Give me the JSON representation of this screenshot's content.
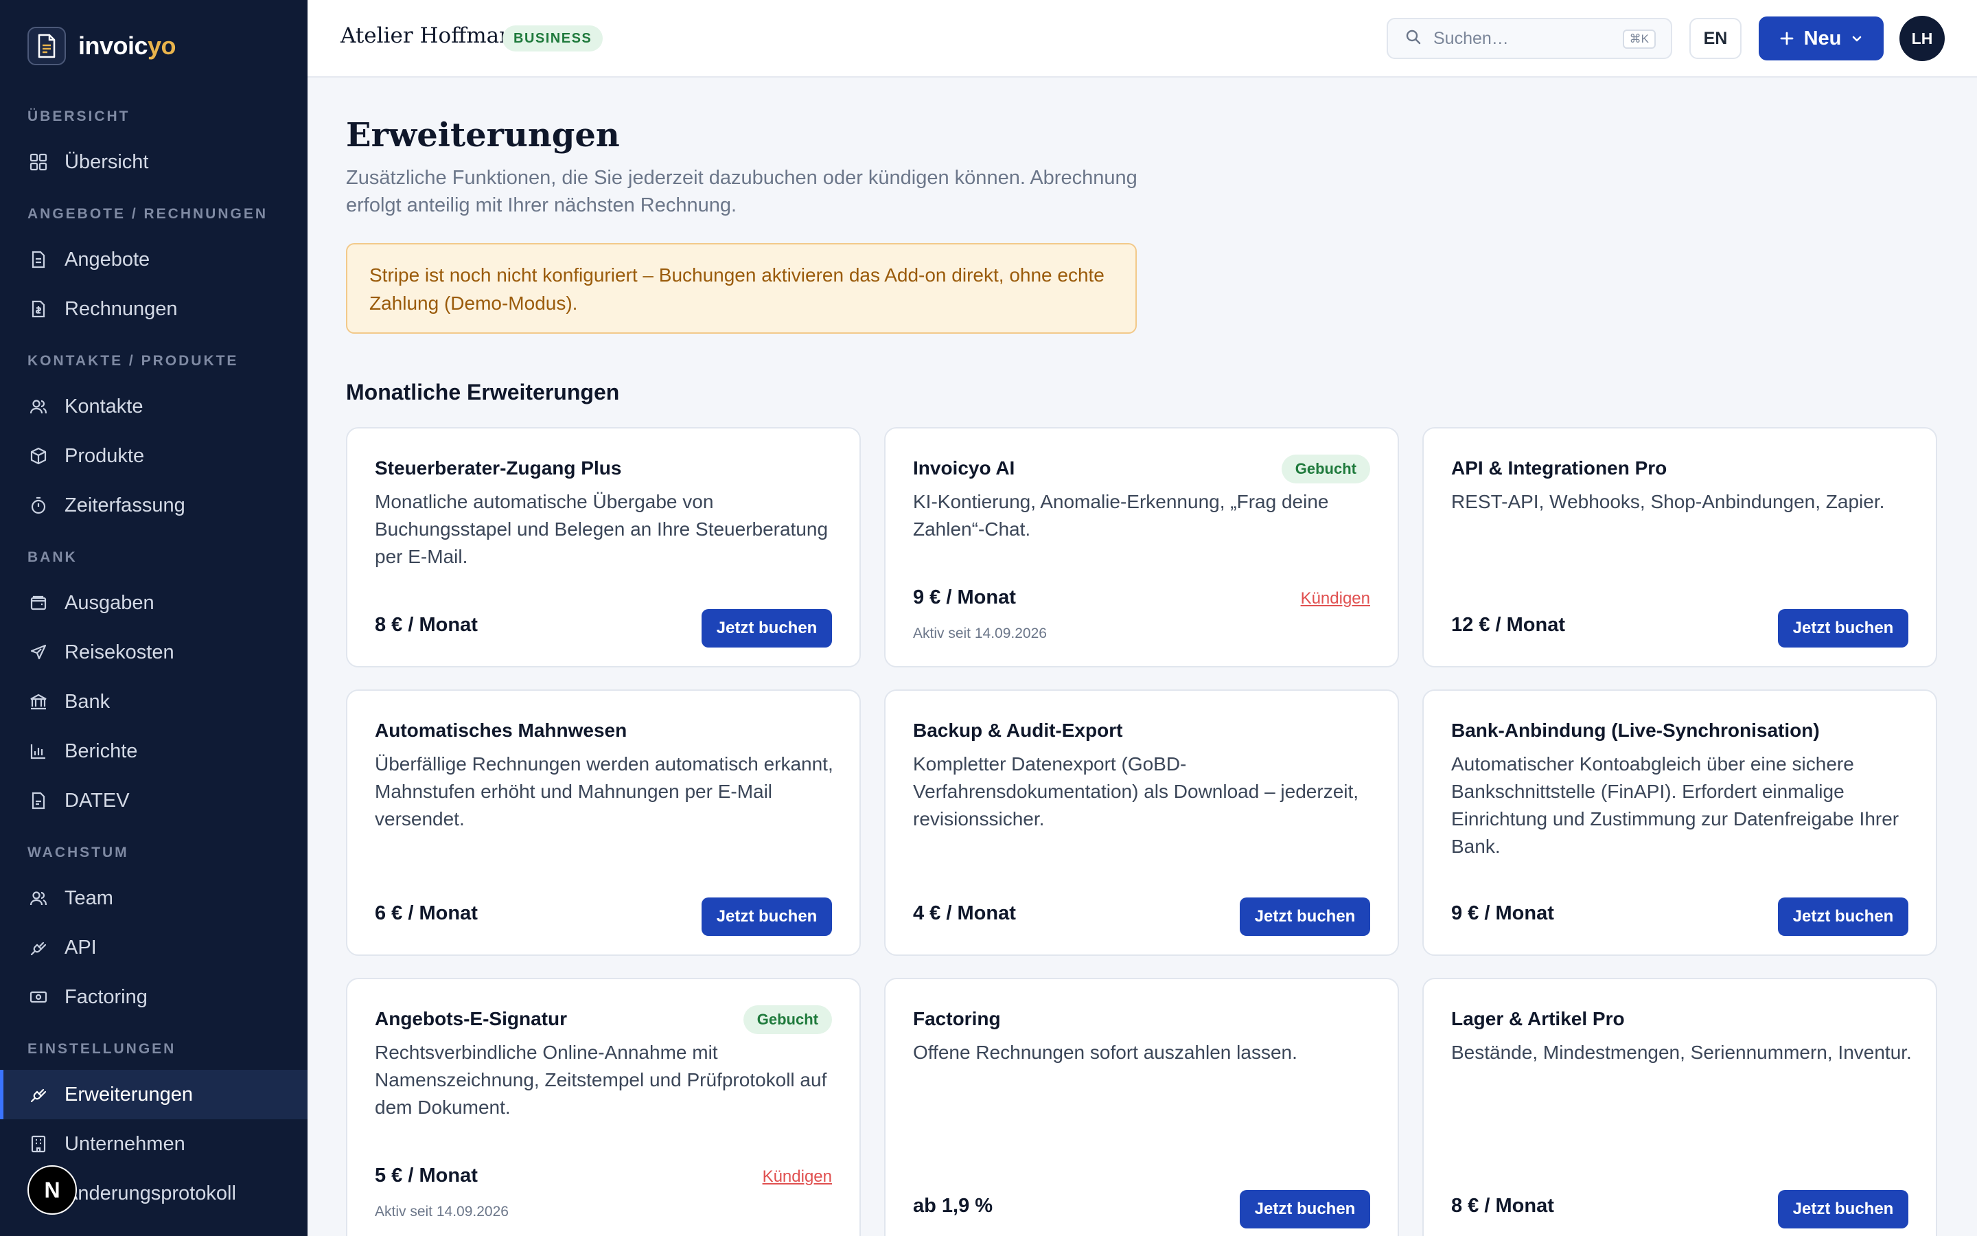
{
  "brand": {
    "name_main": "invoic",
    "name_accent": "yo"
  },
  "sidebar": {
    "sections": [
      {
        "title": "ÜBERSICHT",
        "items": [
          {
            "label": "Übersicht",
            "icon": "grid-icon"
          }
        ]
      },
      {
        "title": "ANGEBOTE / RECHNUNGEN",
        "items": [
          {
            "label": "Angebote",
            "icon": "document-icon"
          },
          {
            "label": "Rechnungen",
            "icon": "invoice-icon"
          }
        ]
      },
      {
        "title": "KONTAKTE / PRODUKTE",
        "items": [
          {
            "label": "Kontakte",
            "icon": "users-icon"
          },
          {
            "label": "Produkte",
            "icon": "box-icon"
          },
          {
            "label": "Zeiterfassung",
            "icon": "stopwatch-icon"
          }
        ]
      },
      {
        "title": "BANK",
        "items": [
          {
            "label": "Ausgaben",
            "icon": "wallet-icon"
          },
          {
            "label": "Reisekosten",
            "icon": "plane-icon"
          },
          {
            "label": "Bank",
            "icon": "bank-icon"
          },
          {
            "label": "Berichte",
            "icon": "bar-chart-icon"
          },
          {
            "label": "DATEV",
            "icon": "file-icon"
          }
        ]
      },
      {
        "title": "WACHSTUM",
        "items": [
          {
            "label": "Team",
            "icon": "users-icon"
          },
          {
            "label": "API",
            "icon": "plug-icon"
          },
          {
            "label": "Factoring",
            "icon": "cash-icon"
          }
        ]
      },
      {
        "title": "EINSTELLUNGEN",
        "items": [
          {
            "label": "Erweiterungen",
            "icon": "plug-icon",
            "active": true
          },
          {
            "label": "Unternehmen",
            "icon": "building-icon"
          },
          {
            "label": "Änderungsprotokoll",
            "icon": "history-icon"
          }
        ]
      }
    ],
    "dev_badge": "N"
  },
  "header": {
    "company": "Atelier Hoffmann",
    "plan": "BUSINESS",
    "search_placeholder": "Suchen…",
    "search_shortcut": "⌘K",
    "language": "EN",
    "new_label": "Neu",
    "avatar": "LH"
  },
  "page": {
    "title": "Erweiterungen",
    "subtitle": "Zusätzliche Funktionen, die Sie jederzeit dazubuchen oder kündigen können. Abrechnung erfolgt anteilig mit Ihrer nächsten Rechnung.",
    "alert": "Stripe ist noch nicht konfiguriert – Buchungen aktivieren das Add-on direkt, ohne echte Zahlung (Demo-Modus).",
    "section_title": "Monatliche Erweiterungen"
  },
  "addons": [
    {
      "title": "Steuerberater-Zugang Plus",
      "description": "Monatliche automatische Übergabe von Buchungsstapel und Belegen an Ihre Steuerberatung per E-Mail.",
      "price": "8 € / Monat",
      "action": "Jetzt buchen",
      "booked": false
    },
    {
      "title": "Invoicyo AI",
      "description": "KI-Kontierung, Anomalie-Erkennung, „Frag deine Zahlen“-Chat.",
      "price": "9 € / Monat",
      "booked": true,
      "badge": "Gebucht",
      "cancel": "Kündigen",
      "active_since": "Aktiv seit 14.09.2026"
    },
    {
      "title": "API & Integrationen Pro",
      "description": "REST-API, Webhooks, Shop-Anbindungen, Zapier.",
      "price": "12 € / Monat",
      "action": "Jetzt buchen",
      "booked": false
    },
    {
      "title": "Automatisches Mahnwesen",
      "description": "Überfällige Rechnungen werden automatisch erkannt, Mahnstufen erhöht und Mahnungen per E-Mail versendet.",
      "price": "6 € / Monat",
      "action": "Jetzt buchen",
      "booked": false
    },
    {
      "title": "Backup & Audit-Export",
      "description": "Kompletter Datenexport (GoBD-Verfahrensdokumentation) als Download – jederzeit, revisionssicher.",
      "price": "4 € / Monat",
      "action": "Jetzt buchen",
      "booked": false
    },
    {
      "title": "Bank-Anbindung (Live-Synchronisation)",
      "description": "Automatischer Kontoabgleich über eine sichere Bankschnittstelle (FinAPI). Erfordert einmalige Einrichtung und Zustimmung zur Datenfreigabe Ihrer Bank.",
      "price": "9 € / Monat",
      "action": "Jetzt buchen",
      "booked": false
    },
    {
      "title": "Angebots-E-Signatur",
      "description": "Rechtsverbindliche Online-Annahme mit Namenszeichnung, Zeitstempel und Prüfprotokoll auf dem Dokument.",
      "price": "5 € / Monat",
      "booked": true,
      "badge": "Gebucht",
      "cancel": "Kündigen",
      "active_since": "Aktiv seit 14.09.2026"
    },
    {
      "title": "Factoring",
      "description": "Offene Rechnungen sofort auszahlen lassen.",
      "price": "ab 1,9 %",
      "action": "Jetzt buchen",
      "booked": false
    },
    {
      "title": "Lager & Artikel Pro",
      "description": "Bestände, Mindestmengen, Seriennummern, Inventur.",
      "price": "8 € / Monat",
      "action": "Jetzt buchen",
      "booked": false
    }
  ]
}
